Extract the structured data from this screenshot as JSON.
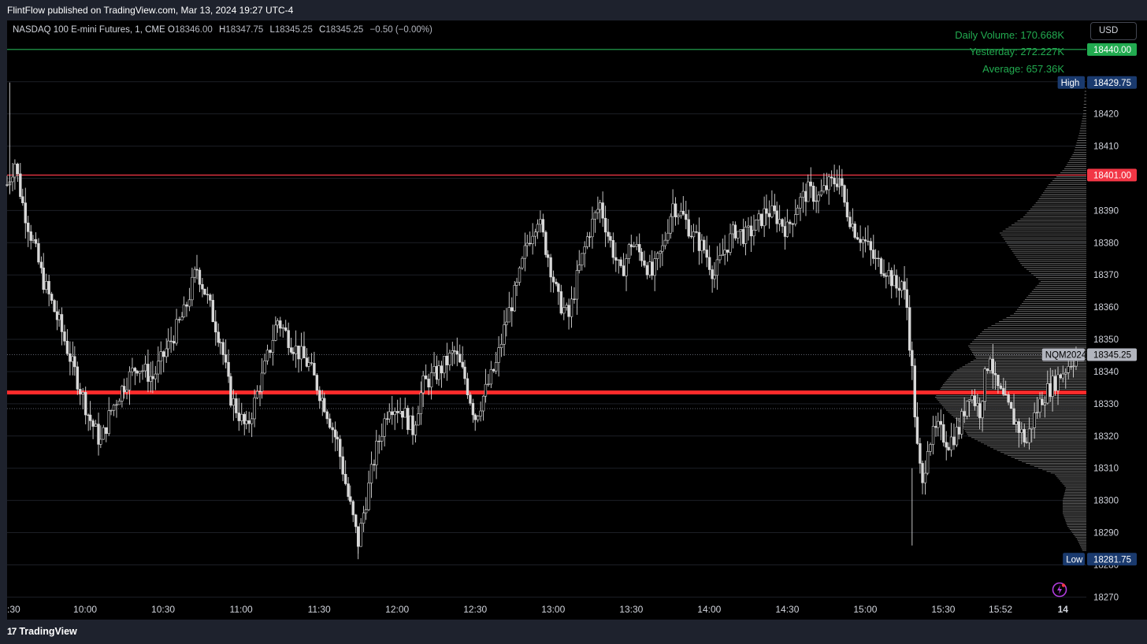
{
  "header": {
    "publish_text": "FlintFlow published on TradingView.com, Mar 13, 2024 19:27 UTC-4"
  },
  "symbol": {
    "name": "NASDAQ 100 E-mini Futures, 1, CME",
    "open_label": "O",
    "open": "18346.00",
    "high_label": "H",
    "high": "18347.75",
    "low_label": "L",
    "low": "18345.25",
    "close_label": "C",
    "close": "18345.25",
    "change": "−0.50 (−0.00%)"
  },
  "volume": {
    "daily": "Daily Volume: 170.668K",
    "yesterday": "Yesterday: 272.227K",
    "average": "Average: 657.36K"
  },
  "currency_button": "USD",
  "footer": {
    "logo_mark": "17",
    "logo_text": "TradingView"
  },
  "colors": {
    "background": "#000000",
    "chrome": "#1e222d",
    "green": "#22ab50",
    "red": "#f23645",
    "red_line": "#ff2b2b",
    "high_low_badge": "#1a3a6e",
    "candle": "#d8d8d8",
    "profile": "#8a8a8a"
  },
  "chart_data": {
    "type": "candlestick",
    "title": "NASDAQ 100 E-mini Futures, 1, CME",
    "ylim": [
      18263,
      18449
    ],
    "y_ticks": [
      18420,
      18410,
      18390,
      18380,
      18370,
      18360,
      18350,
      18340,
      18330,
      18320,
      18310,
      18300,
      18290,
      18280,
      18270
    ],
    "x_ticks": [
      ":30",
      "10:00",
      "10:30",
      "11:00",
      "11:30",
      "12:00",
      "12:30",
      "13:00",
      "13:30",
      "14:00",
      "14:30",
      "15:00",
      "15:30",
      "15:52",
      "14"
    ],
    "x_range_minutes": [
      570,
      985
    ],
    "horizontal_lines": [
      {
        "value": 18440.0,
        "color": "#22ab50",
        "label": "18440.00"
      },
      {
        "value": 18401.0,
        "color": "#f23645",
        "label": "18401.00"
      },
      {
        "value": 18333.5,
        "color": "#ff2b2b",
        "label": ""
      }
    ],
    "price_tags": [
      {
        "value": 18429.75,
        "label": "18429.75",
        "tag": "High"
      },
      {
        "value": 18281.75,
        "label": "18281.75",
        "tag": "Low"
      },
      {
        "value": 18345.25,
        "label": "18345.25",
        "tag": "NQM2024"
      }
    ],
    "path_points": [
      [
        570,
        18398
      ],
      [
        573,
        18405
      ],
      [
        576,
        18392
      ],
      [
        580,
        18380
      ],
      [
        584,
        18368
      ],
      [
        590,
        18355
      ],
      [
        596,
        18340
      ],
      [
        602,
        18325
      ],
      [
        606,
        18318
      ],
      [
        610,
        18328
      ],
      [
        615,
        18336
      ],
      [
        620,
        18342
      ],
      [
        626,
        18338
      ],
      [
        632,
        18348
      ],
      [
        638,
        18358
      ],
      [
        643,
        18372
      ],
      [
        646,
        18365
      ],
      [
        652,
        18350
      ],
      [
        656,
        18332
      ],
      [
        662,
        18322
      ],
      [
        668,
        18338
      ],
      [
        674,
        18356
      ],
      [
        680,
        18348
      ],
      [
        686,
        18342
      ],
      [
        692,
        18330
      ],
      [
        697,
        18318
      ],
      [
        702,
        18298
      ],
      [
        705,
        18287
      ],
      [
        708,
        18300
      ],
      [
        712,
        18316
      ],
      [
        717,
        18330
      ],
      [
        722,
        18328
      ],
      [
        726,
        18322
      ],
      [
        730,
        18336
      ],
      [
        736,
        18340
      ],
      [
        742,
        18346
      ],
      [
        746,
        18338
      ],
      [
        750,
        18326
      ],
      [
        754,
        18334
      ],
      [
        758,
        18342
      ],
      [
        762,
        18356
      ],
      [
        766,
        18366
      ],
      [
        770,
        18380
      ],
      [
        774,
        18388
      ],
      [
        778,
        18376
      ],
      [
        782,
        18362
      ],
      [
        786,
        18357
      ],
      [
        790,
        18372
      ],
      [
        794,
        18384
      ],
      [
        798,
        18392
      ],
      [
        802,
        18380
      ],
      [
        806,
        18370
      ],
      [
        810,
        18380
      ],
      [
        814,
        18376
      ],
      [
        818,
        18370
      ],
      [
        822,
        18378
      ],
      [
        826,
        18392
      ],
      [
        830,
        18388
      ],
      [
        834,
        18382
      ],
      [
        838,
        18378
      ],
      [
        842,
        18370
      ],
      [
        846,
        18378
      ],
      [
        850,
        18384
      ],
      [
        854,
        18382
      ],
      [
        858,
        18385
      ],
      [
        862,
        18390
      ],
      [
        866,
        18388
      ],
      [
        870,
        18384
      ],
      [
        874,
        18392
      ],
      [
        878,
        18396
      ],
      [
        882,
        18394
      ],
      [
        886,
        18398
      ],
      [
        890,
        18400
      ],
      [
        892,
        18392
      ],
      [
        896,
        18384
      ],
      [
        900,
        18380
      ],
      [
        904,
        18374
      ],
      [
        908,
        18372
      ],
      [
        912,
        18366
      ],
      [
        914,
        18368
      ],
      [
        916,
        18360
      ],
      [
        918,
        18340
      ],
      [
        920,
        18316
      ],
      [
        922,
        18304
      ],
      [
        924,
        18318
      ],
      [
        928,
        18322
      ],
      [
        932,
        18318
      ],
      [
        936,
        18322
      ],
      [
        940,
        18334
      ],
      [
        944,
        18328
      ],
      [
        946,
        18338
      ],
      [
        948,
        18346
      ],
      [
        950,
        18336
      ],
      [
        954,
        18330
      ],
      [
        958,
        18324
      ],
      [
        962,
        18318
      ],
      [
        964,
        18324
      ],
      [
        968,
        18332
      ],
      [
        972,
        18336
      ],
      [
        976,
        18340
      ],
      [
        980,
        18344
      ],
      [
        982,
        18345.25
      ]
    ],
    "volume_profile": [
      [
        18428,
        2
      ],
      [
        18420,
        4
      ],
      [
        18414,
        9
      ],
      [
        18408,
        16
      ],
      [
        18403,
        28
      ],
      [
        18398,
        48
      ],
      [
        18393,
        62
      ],
      [
        18388,
        80
      ],
      [
        18383,
        110
      ],
      [
        18378,
        96
      ],
      [
        18373,
        82
      ],
      [
        18368,
        58
      ],
      [
        18363,
        76
      ],
      [
        18358,
        92
      ],
      [
        18353,
        130
      ],
      [
        18348,
        150
      ],
      [
        18344,
        140
      ],
      [
        18340,
        168
      ],
      [
        18336,
        182
      ],
      [
        18332,
        192
      ],
      [
        18328,
        178
      ],
      [
        18324,
        160
      ],
      [
        18320,
        150
      ],
      [
        18316,
        118
      ],
      [
        18312,
        82
      ],
      [
        18308,
        40
      ],
      [
        18304,
        26
      ],
      [
        18300,
        30
      ],
      [
        18296,
        30
      ],
      [
        18292,
        24
      ],
      [
        18288,
        12
      ],
      [
        18284,
        4
      ]
    ]
  }
}
